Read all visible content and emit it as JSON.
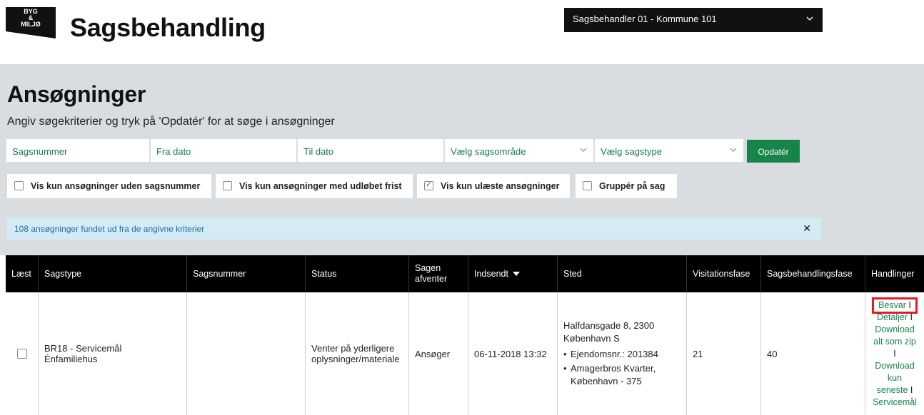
{
  "header": {
    "logo_lines": [
      "BYG",
      "&",
      "MILJØ"
    ],
    "app_title": "Sagsbehandling",
    "user_select": "Sagsbehandler 01 - Kommune 101"
  },
  "panel": {
    "title": "Ansøgninger",
    "subtitle": "Angiv søgekriterier og tryk på 'Opdatér' for at søge i ansøgninger",
    "fields": {
      "sagsnummer": "Sagsnummer",
      "fra_dato": "Fra dato",
      "til_dato": "Til dato",
      "sagsomraade": "Vælg sagsområde",
      "sagstype": "Vælg sagstype"
    },
    "update_button": "Opdatér",
    "checks": {
      "uden_sagsnummer": "Vis kun ansøgninger uden sagsnummer",
      "udloebet_frist": "Vis kun ansøgninger med udløbet frist",
      "ulaeste": "Vis kun ulæste ansøgninger",
      "grupper": "Gruppér på sag"
    },
    "info": "108 ansøgninger fundet ud fra de angivne kriterier"
  },
  "table": {
    "headers": {
      "laest": "Læst",
      "sagstype": "Sagstype",
      "sagsnummer": "Sagsnummer",
      "status": "Status",
      "afventer_1": "Sagen",
      "afventer_2": "afventer",
      "indsendt": "Indsendt",
      "sted": "Sted",
      "visitation": "Visitationsfase",
      "sagsbehandling": "Sagsbehandlingsfase",
      "handlinger": "Handlinger"
    },
    "row": {
      "sagstype_1": "BR18 - Servicemål",
      "sagstype_2": "Énfamiliehus",
      "sagsnummer": "",
      "status_1": "Venter på yderligere",
      "status_2": "oplysninger/materiale",
      "afventer": "Ansøger",
      "indsendt": "06-11-2018 13:32",
      "sted_1": "Halfdansgade 8, 2300",
      "sted_2": "København S",
      "sted_b1": "Ejendomsnr.: 201384",
      "sted_b2_1": "Amagerbros Kvarter,",
      "sted_b2_2": "København - 375",
      "visitation": "21",
      "sagsbehandling": "40",
      "actions": {
        "besvar": "Besvar",
        "detaljer": "Detaljer",
        "download_zip_1": "Download",
        "download_zip_2": "alt som zip",
        "download_seneste_1": "Download",
        "download_seneste_2": "kun",
        "download_seneste_3": "seneste",
        "servicemaal": "Servicemål",
        "separator": "I"
      }
    }
  }
}
